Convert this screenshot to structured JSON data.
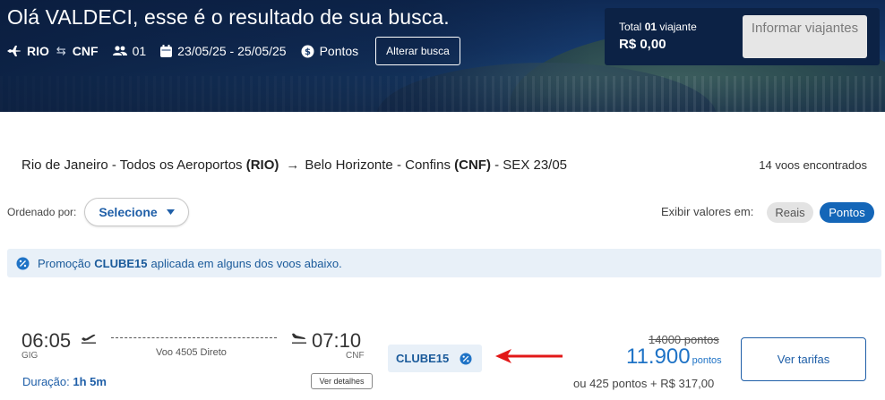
{
  "header": {
    "greeting": "Olá VALDECI, esse é o resultado de sua busca.",
    "origin": "RIO",
    "destination": "CNF",
    "passengers": "01",
    "dates": "23/05/25 - 25/05/25",
    "currency_mode": "Pontos",
    "alter_button": "Alterar busca"
  },
  "total": {
    "label_prefix": "Total",
    "label_count": "01",
    "label_suffix": "viajante",
    "value": "R$ 0,00",
    "info_button": "Informar viajantes"
  },
  "route": {
    "origin_name": "Rio de Janeiro - Todos os Aeroportos",
    "origin_code": "(RIO)",
    "destination_name": "Belo Horizonte - Confins",
    "destination_code": "(CNF)",
    "date": "- SEX 23/05",
    "found": "14 voos encontrados"
  },
  "sort": {
    "label": "Ordenado por:",
    "value": "Selecione"
  },
  "display": {
    "label": "Exibir valores em:",
    "options": [
      "Reais",
      "Pontos"
    ],
    "selected": "Pontos"
  },
  "promo": {
    "prefix": "Promoção",
    "code": "CLUBE15",
    "suffix": "aplicada em alguns dos voos abaixo."
  },
  "flight": {
    "departure_time": "06:05",
    "departure_airport": "GIG",
    "arrival_time": "07:10",
    "arrival_airport": "CNF",
    "flight_info": "Voo 4505 Direto",
    "duration_label": "Duração:",
    "duration_value": "1h 5m",
    "details_button": "Ver detalhes",
    "promo_badge": "CLUBE15",
    "old_price": "14000 pontos",
    "new_price": "11.900",
    "new_price_unit": "pontos",
    "alt_price": "ou 425 pontos + R$ 317,00",
    "fares_button": "Ver tarifas"
  },
  "colors": {
    "brand_blue": "#1f5fa8",
    "accent_blue": "#1466b8",
    "promo_bg": "#e8f0f8",
    "annotation_arrow": "#e21818"
  }
}
